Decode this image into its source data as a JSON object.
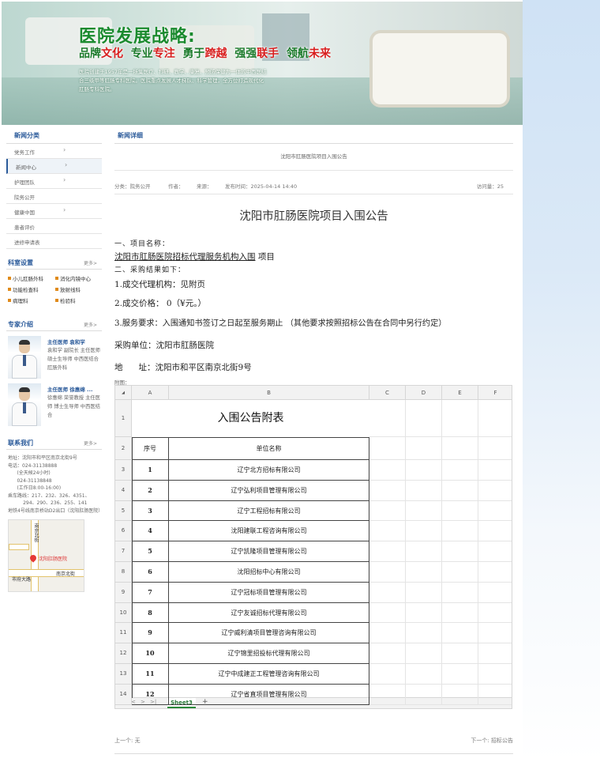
{
  "banner": {
    "title": "医院发展战略:",
    "slogan_parts": [
      {
        "text": "品牌",
        "color": "g"
      },
      {
        "text": "文化",
        "color": "r"
      },
      {
        "text": "  专业",
        "color": "g"
      },
      {
        "text": "专注",
        "color": "r"
      },
      {
        "text": "  勇于",
        "color": "g"
      },
      {
        "text": "跨越",
        "color": "r"
      },
      {
        "text": "  强强",
        "color": "g"
      },
      {
        "text": "联手",
        "color": "r"
      },
      {
        "text": "  领航",
        "color": "g"
      },
      {
        "text": "未来",
        "color": "r"
      }
    ],
    "description": "医院创建于1957年是一所集医疗、科研、教学、康复、预防保健为一体的中西医结合三级甲等肛肠专科医院。医院重点发展人才梯队、科学管理，全方位打造现代化肛肠专科医院。"
  },
  "sidebar": {
    "news_header": "新闻分类",
    "nav": [
      {
        "label": "党务工作",
        "chevron": true,
        "active": false
      },
      {
        "label": "新闻中心",
        "chevron": true,
        "active": true
      },
      {
        "label": "护理团队",
        "chevron": true,
        "active": false
      },
      {
        "label": "院务公开",
        "chevron": false,
        "active": false
      },
      {
        "label": "健康中国",
        "chevron": true,
        "active": false
      },
      {
        "label": "患者评价",
        "chevron": false,
        "active": false
      },
      {
        "label": "进修申请表",
        "chevron": false,
        "active": false
      }
    ],
    "departments": {
      "header": "科室设置",
      "more": "更多>",
      "items": [
        "小儿肛肠外科",
        "消化内镜中心",
        "功能检查科",
        "放射线科",
        "病理科",
        "检验科"
      ]
    },
    "experts": {
      "header": "专家介绍",
      "more": "更多>",
      "items": [
        {
          "name": "主任医师 袁和学",
          "bio": "袁和学 副院长 主任医师 硕士生导师 中西医结合肛肠外科"
        },
        {
          "name": "主任医师 徐惠绵 ...",
          "bio": "徐惠绵 荣誉教授 主任医师 博士生导师 中西医结合"
        }
      ]
    },
    "contact": {
      "header": "联系我们",
      "more": "更多>",
      "lines": [
        "地址：沈阳市和平区南京北街9号",
        "电话：024-31138888",
        "      (全天候24小时)",
        "      024-31138848",
        "      (工作日8:00-16:00)",
        "乘车路线：217、232、326、4351、",
        "          294、290、236、255、141",
        "地铁4号线南京桥站D2出口（沈阳肛肠医院）"
      ],
      "map": {
        "pin_label": "沈阳肛肠医院",
        "roads": [
          "南京北街",
          "市府大路",
          "南京北街"
        ]
      }
    }
  },
  "main": {
    "header": "新闻详细",
    "breadcrumb_title": "沈阳市肛肠医院项目入围公告",
    "meta": {
      "category": "分类：院务公开",
      "author": "作者：",
      "source": "来源：",
      "published": "发布时间：2025-04-14 14:40",
      "views": "访问量：25"
    },
    "article": {
      "title": "沈阳市肛肠医院项目入围公告",
      "sec1": "一、项目名称：",
      "project_name": "  沈阳市肛肠医院招标代理服务机构入围",
      "project_suffix": " 项目",
      "sec2": "二、采购结果如下：",
      "item1": "1.成交代理机构：见附页",
      "item2": "2.成交价格：  0（¥元。）",
      "item3": "3.服务要求：入围通知书签订之日起至服务期止 （其他要求按照招标公告在合同中另行约定）",
      "buyer": "采购单位：沈阳市肛肠医院",
      "address_label": "地      址：沈阳市和平区南京北街9号",
      "attachment_label": "附图："
    }
  },
  "sheet": {
    "columns": [
      "A",
      "B",
      "C",
      "D",
      "E",
      "F"
    ],
    "title": "入围公告附表",
    "headers": [
      "序号",
      "单位名称"
    ],
    "rows": [
      {
        "no": "1",
        "name": "辽宁北方招标有限公司"
      },
      {
        "no": "2",
        "name": "辽宁弘利项目管理有限公司"
      },
      {
        "no": "3",
        "name": "辽宁工程招标有限公司"
      },
      {
        "no": "4",
        "name": "沈阳建联工程咨询有限公司"
      },
      {
        "no": "5",
        "name": "辽宁凯隆项目管理有限公司"
      },
      {
        "no": "6",
        "name": "沈阳招标中心有限公司"
      },
      {
        "no": "7",
        "name": "辽宁冠标项目管理有限公司"
      },
      {
        "no": "8",
        "name": "辽宁友诚招标代理有限公司"
      },
      {
        "no": "9",
        "name": "辽宁威利清项目管理咨询有限公司"
      },
      {
        "no": "10",
        "name": "辽宁锦里招投标代理有限公司"
      },
      {
        "no": "11",
        "name": "辽宁中成建正工程管理咨询有限公司"
      },
      {
        "no": "12",
        "name": "辽宁省直项目管理有限公司"
      }
    ],
    "row_numbers": [
      "1",
      "2",
      "3",
      "4",
      "5",
      "6",
      "7",
      "8",
      "9",
      "10",
      "11",
      "12",
      "13",
      "14"
    ],
    "tab": "Sheet3",
    "nav_buttons": [
      "|<",
      "<",
      ">",
      ">|"
    ]
  },
  "footer": {
    "prev": "上一个: 无",
    "next": "下一个: 招标公告"
  }
}
